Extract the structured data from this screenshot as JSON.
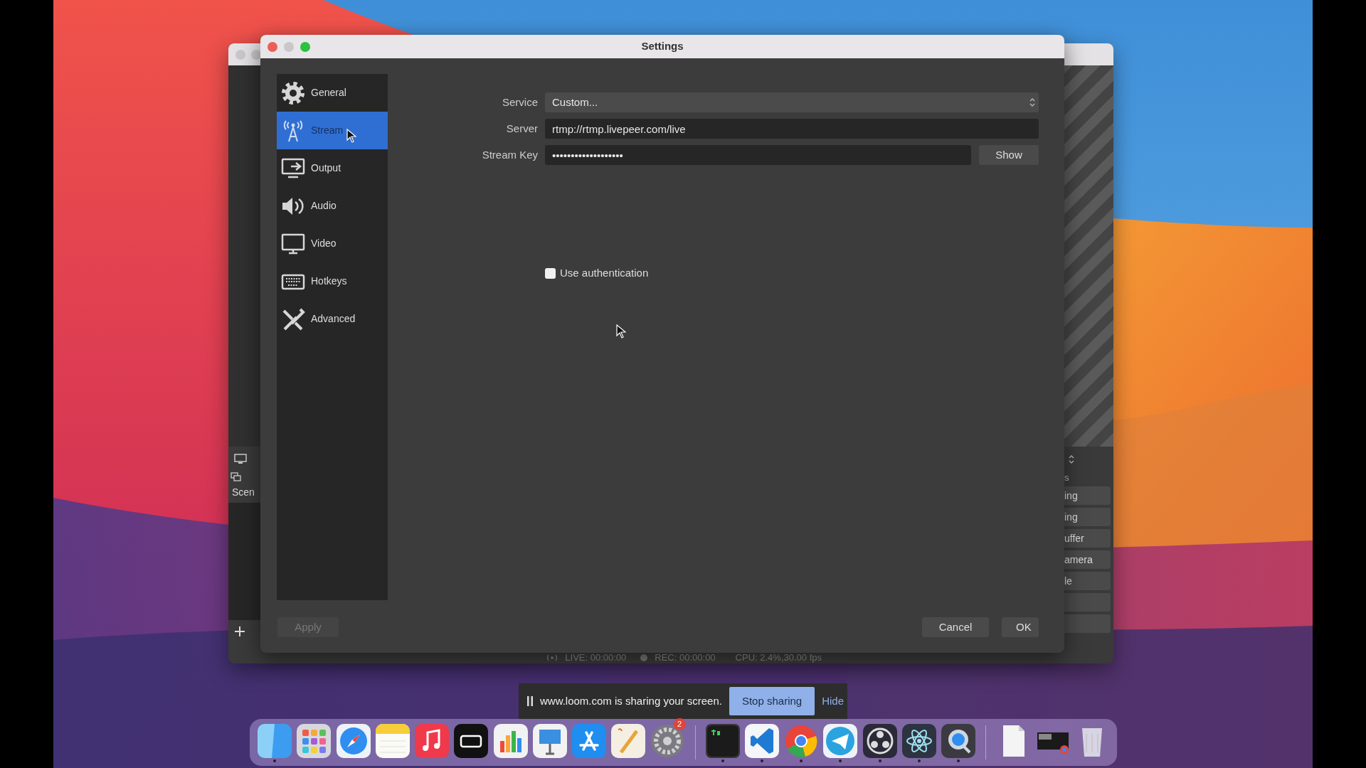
{
  "background_window": {
    "scenes_header": "Scen",
    "controls_header": "s",
    "controls": [
      "ing",
      "ing",
      "uffer",
      "amera",
      "le"
    ],
    "status": [
      "LIVE: 00:00:00",
      "REC: 00:00:00",
      "CPU: 2.4%,30.00 fps"
    ]
  },
  "settings_window": {
    "title": "Settings",
    "sidebar": [
      {
        "label": "General",
        "selected": false
      },
      {
        "label": "Stream",
        "selected": true
      },
      {
        "label": "Output",
        "selected": false
      },
      {
        "label": "Audio",
        "selected": false
      },
      {
        "label": "Video",
        "selected": false
      },
      {
        "label": "Hotkeys",
        "selected": false
      },
      {
        "label": "Advanced",
        "selected": false
      }
    ],
    "service": {
      "label": "Service",
      "value": "Custom..."
    },
    "server": {
      "label": "Server",
      "value": "rtmp://rtmp.livepeer.com/live"
    },
    "stream_key": {
      "label": "Stream Key",
      "value": "•••••••••••••••••••",
      "button": "Show"
    },
    "use_authentication": {
      "label": "Use authentication",
      "checked": false
    },
    "apply": {
      "label": "Apply",
      "disabled": true
    },
    "buttons": [
      "Cancel",
      "OK"
    ]
  },
  "sharing_bar": {
    "message": "www.loom.com is sharing your screen.",
    "stop": "Stop sharing",
    "hide": "Hide"
  },
  "dock": {
    "groups": [
      [
        {
          "running": true
        },
        {
          "running": false
        },
        {
          "running": false
        },
        {
          "running": false
        },
        {
          "running": false
        },
        {
          "running": false
        },
        {
          "running": false
        },
        {
          "running": false
        },
        {
          "running": false
        },
        {
          "running": false
        },
        {
          "running": false,
          "badge": "2"
        }
      ],
      [
        {
          "running": true
        },
        {
          "running": true
        },
        {
          "running": true
        },
        {
          "running": true
        },
        {
          "running": true
        },
        {
          "running": true
        },
        {
          "running": true
        }
      ],
      [
        {
          "running": false
        },
        {
          "running": false
        },
        {
          "running": false
        }
      ]
    ]
  }
}
